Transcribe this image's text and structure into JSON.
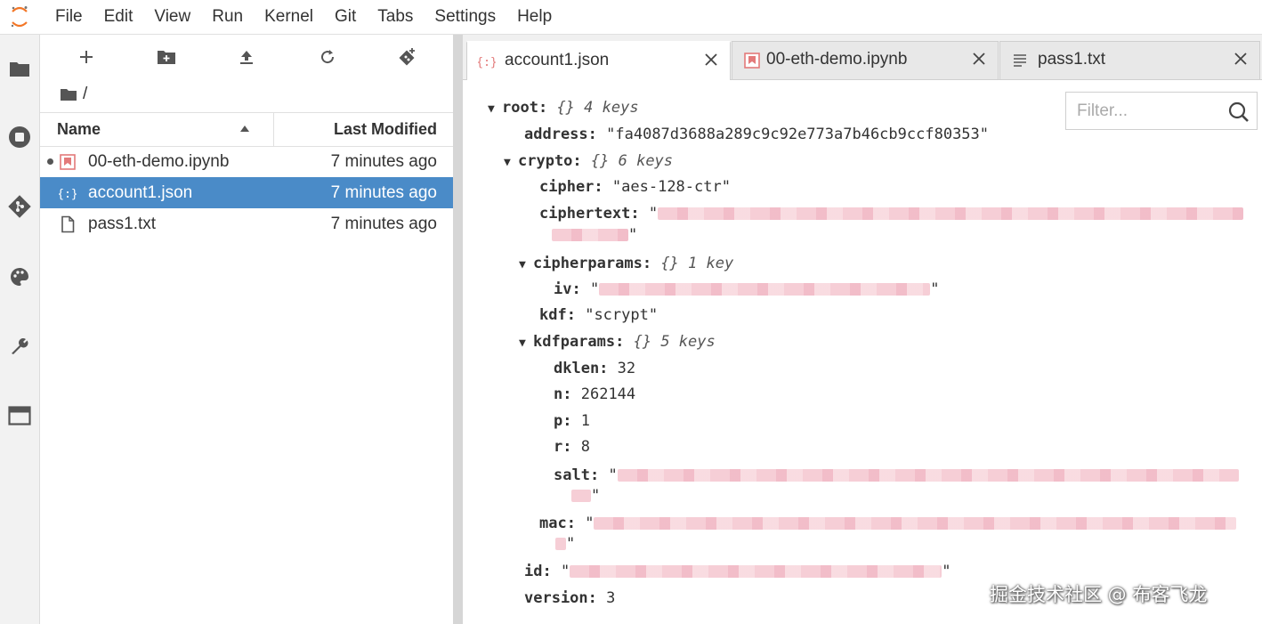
{
  "menu": [
    "File",
    "Edit",
    "View",
    "Run",
    "Kernel",
    "Git",
    "Tabs",
    "Settings",
    "Help"
  ],
  "file_browser": {
    "breadcrumb": "/",
    "col_name": "Name",
    "col_modified": "Last Modified",
    "files": [
      {
        "name": "00-eth-demo.ipynb",
        "modified": "7 minutes ago",
        "type": "notebook",
        "running": true,
        "selected": false
      },
      {
        "name": "account1.json",
        "modified": "7 minutes ago",
        "type": "json",
        "running": false,
        "selected": true
      },
      {
        "name": "pass1.txt",
        "modified": "7 minutes ago",
        "type": "text",
        "running": false,
        "selected": false
      }
    ]
  },
  "tabs": [
    {
      "label": "account1.json",
      "icon": "json-icon",
      "active": true
    },
    {
      "label": "00-eth-demo.ipynb",
      "icon": "notebook-icon",
      "active": false
    },
    {
      "label": "pass1.txt",
      "icon": "text-file-icon",
      "active": false
    }
  ],
  "filter": {
    "placeholder": "Filter..."
  },
  "json_view": {
    "root": {
      "key": "root:",
      "meta": "{} 4 keys"
    },
    "address": {
      "key": "address:",
      "value": "\"fa4087d3688a289c9c92e773a7b46cb9ccf80353\""
    },
    "crypto": {
      "key": "crypto:",
      "meta": "{} 6 keys"
    },
    "cipher": {
      "key": "cipher:",
      "value": "\"aes-128-ctr\""
    },
    "ciphertext": {
      "key": "ciphertext:",
      "open_quote": "\"",
      "close_quote": "\""
    },
    "cipherparams": {
      "key": "cipherparams:",
      "meta": "{} 1 key"
    },
    "iv": {
      "key": "iv:",
      "open_quote": "\"",
      "close_quote": "\""
    },
    "kdf": {
      "key": "kdf:",
      "value": "\"scrypt\""
    },
    "kdfparams": {
      "key": "kdfparams:",
      "meta": "{} 5 keys"
    },
    "dklen": {
      "key": "dklen:",
      "value": "32"
    },
    "n": {
      "key": "n:",
      "value": "262144"
    },
    "p": {
      "key": "p:",
      "value": "1"
    },
    "r": {
      "key": "r:",
      "value": "8"
    },
    "salt": {
      "key": "salt:",
      "open_quote": "\"",
      "close_quote": "\""
    },
    "mac": {
      "key": "mac:",
      "open_quote": "\"",
      "close_quote": "\""
    },
    "id": {
      "key": "id:",
      "open_quote": "\"",
      "close_quote": "\""
    },
    "version": {
      "key": "version:",
      "value": "3"
    }
  },
  "watermark": "掘金技术社区 @ 布客飞龙",
  "colors": {
    "selection": "#4a8bc8",
    "redaction": "#f5c9d2",
    "logo": "#f37626"
  }
}
